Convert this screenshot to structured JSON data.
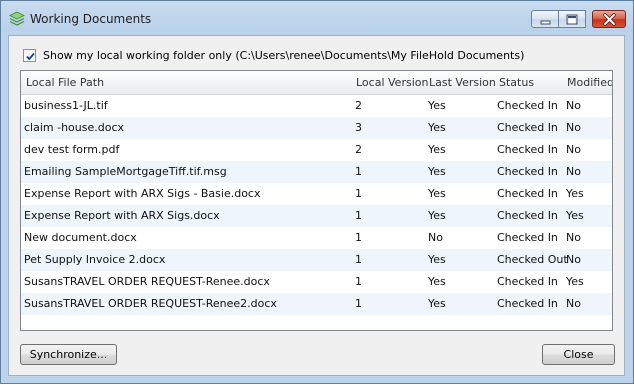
{
  "window": {
    "title": "Working Documents",
    "icon": "filehold-stack-icon"
  },
  "title_controls": {
    "minimize": "minimize-icon",
    "maximize": "maximize-icon",
    "close": "close-icon"
  },
  "filter": {
    "checked": true,
    "label": "Show my local working folder only (C:\\Users\\renee\\Documents\\My FileHold Documents)"
  },
  "table": {
    "columns": [
      "Local File Path",
      "Local Version",
      "Last Version",
      "Status",
      "Modified"
    ],
    "rows": [
      {
        "path": "business1-JL.tif",
        "local_version": "2",
        "last_version": "Yes",
        "status": "Checked In",
        "modified": "No"
      },
      {
        "path": "claim -house.docx",
        "local_version": "3",
        "last_version": "Yes",
        "status": "Checked In",
        "modified": "No"
      },
      {
        "path": "dev test form.pdf",
        "local_version": "2",
        "last_version": "Yes",
        "status": "Checked In",
        "modified": "No"
      },
      {
        "path": "Emailing SampleMortgageTiff.tif.msg",
        "local_version": "1",
        "last_version": "Yes",
        "status": "Checked In",
        "modified": "No"
      },
      {
        "path": "Expense Report with ARX Sigs - Basie.docx",
        "local_version": "1",
        "last_version": "Yes",
        "status": "Checked In",
        "modified": "Yes"
      },
      {
        "path": "Expense Report with ARX Sigs.docx",
        "local_version": "1",
        "last_version": "Yes",
        "status": "Checked In",
        "modified": "Yes"
      },
      {
        "path": "New document.docx",
        "local_version": "1",
        "last_version": "No",
        "status": "Checked In",
        "modified": "No"
      },
      {
        "path": "Pet Supply Invoice 2.docx",
        "local_version": "1",
        "last_version": "Yes",
        "status": "Checked Out",
        "modified": "No"
      },
      {
        "path": "SusansTRAVEL ORDER REQUEST-Renee.docx",
        "local_version": "1",
        "last_version": "Yes",
        "status": "Checked In",
        "modified": "Yes"
      },
      {
        "path": "SusansTRAVEL ORDER REQUEST-Renee2.docx",
        "local_version": "1",
        "last_version": "Yes",
        "status": "Checked In",
        "modified": "No"
      }
    ]
  },
  "buttons": {
    "synchronize": "Synchronize...",
    "close": "Close"
  },
  "colors": {
    "title_gradient": "#c9dcf0",
    "row_alt": "#eef5fd",
    "close_button": "#c6321a"
  }
}
